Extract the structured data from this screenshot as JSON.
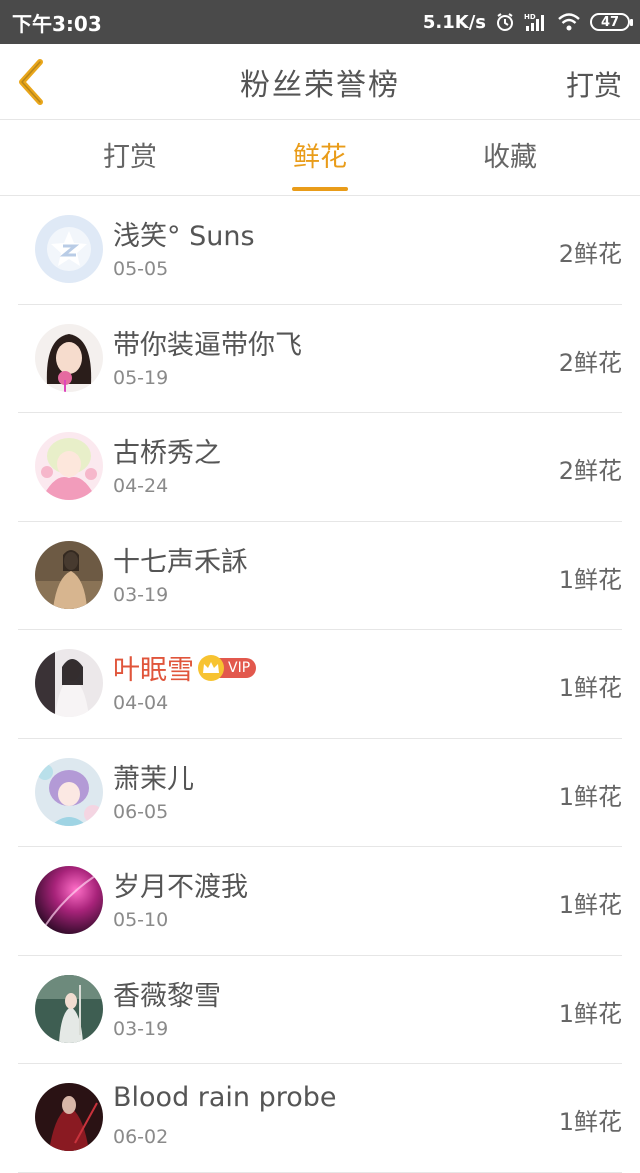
{
  "status_bar": {
    "time": "下午3:03",
    "network_speed": "5.1K/s",
    "battery": "47",
    "icons": [
      "alarm-icon",
      "hd-signal-icon",
      "wifi-icon",
      "battery-icon"
    ]
  },
  "header": {
    "title": "粉丝荣誉榜",
    "action_label": "打赏",
    "back_icon": "chevron-left-icon",
    "accent_color": "#e99c19"
  },
  "tabs": [
    {
      "label": "打赏",
      "active": false
    },
    {
      "label": "鲜花",
      "active": true
    },
    {
      "label": "收藏",
      "active": false
    }
  ],
  "fans": [
    {
      "name": "浅笑° Suns",
      "date": "05-05",
      "count": "2鲜花",
      "vip": false
    },
    {
      "name": "带你装逼带你飞",
      "date": "05-19",
      "count": "2鲜花",
      "vip": false
    },
    {
      "name": "古桥秀之",
      "date": "04-24",
      "count": "2鲜花",
      "vip": false
    },
    {
      "name": "十七声禾訸",
      "date": "03-19",
      "count": "1鲜花",
      "vip": false
    },
    {
      "name": "叶眠雪",
      "date": "04-04",
      "count": "1鲜花",
      "vip": true,
      "vip_label": "VIP"
    },
    {
      "name": "萧茉儿",
      "date": "06-05",
      "count": "1鲜花",
      "vip": false
    },
    {
      "name": "岁月不渡我",
      "date": "05-10",
      "count": "1鲜花",
      "vip": false
    },
    {
      "name": "香薇黎雪",
      "date": "03-19",
      "count": "1鲜花",
      "vip": false
    },
    {
      "name": "Blood rain probe",
      "date": "06-02",
      "count": "1鲜花",
      "vip": false
    }
  ]
}
